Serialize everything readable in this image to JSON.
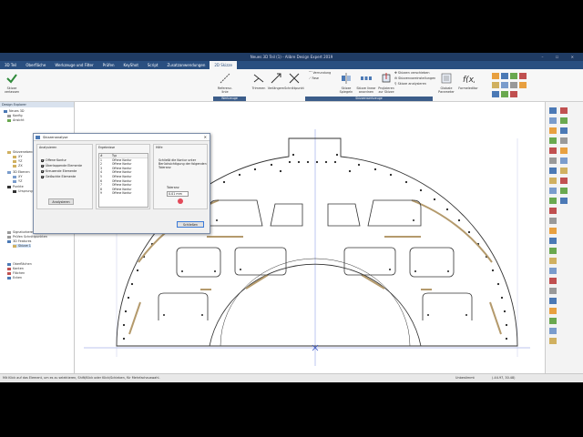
{
  "window": {
    "title": "Neues 3D Teil (1) - Alibre Design Expert 2019",
    "controls": "–  ☐  ✕"
  },
  "menu": [
    {
      "label": "3D Teil",
      "active": false
    },
    {
      "label": "Oberfläche",
      "active": false
    },
    {
      "label": "Werkzeuge und Filter",
      "active": false
    },
    {
      "label": "Prüfen",
      "active": false
    },
    {
      "label": "KeyShot",
      "active": false
    },
    {
      "label": "Script",
      "active": false
    },
    {
      "label": "Zusatzanwendungen",
      "active": false
    },
    {
      "label": "2D Skizze",
      "active": true
    }
  ],
  "ribbon": {
    "buttons": [
      {
        "label": "Skizze verlassen",
        "icon": "exit-sketch-icon"
      },
      {
        "label": "Referenz-linie",
        "icon": "reference-line-icon"
      },
      {
        "label": "Trimmen",
        "icon": "trim-icon"
      },
      {
        "label": "Verlängern",
        "icon": "extend-icon"
      },
      {
        "label": "Schnittpunkt",
        "icon": "intersection-icon"
      },
      {
        "label": "Skizze Spiegeln",
        "icon": "mirror-sketch-icon"
      },
      {
        "label": "Skizze linear anordnen",
        "icon": "linear-pattern-icon"
      },
      {
        "label": "Projizieren zur Skizze",
        "icon": "project-to-sketch-icon"
      },
      {
        "label": "Globale Parameter",
        "icon": "global-parameters-icon"
      },
      {
        "label": "Formeleditor",
        "icon": "formula-editor-icon"
      }
    ],
    "small_items": [
      "Verrundung",
      "Fase",
      "Skizzen verschieben",
      "Skizzenvoreinstellungen",
      "Skizze analysieren"
    ],
    "group_labels": [
      "Werkzeuge",
      "Skizzenwerkzeuge"
    ]
  },
  "explorer": {
    "title": "Design Explorer",
    "items": [
      "Neues 3D",
      "Konfig",
      "Ansicht",
      "Skizzenebenen",
      "XY",
      "YZ",
      "ZX",
      "3D Ebenen",
      "XY",
      "YZ",
      "Punkte",
      "Ursprung",
      "Signaturbereich",
      "Prüfen Schnittpunkten",
      "3D Features",
      "Oberflächen",
      "Kanten",
      "Flächen",
      "Ecken"
    ],
    "selected_item": "Skizze 1"
  },
  "dialog": {
    "title": "Skizzenanalyse",
    "close": "✕",
    "analyze_section_label": "Analysieren",
    "checks": [
      {
        "label": "Offene Kontur",
        "checked": true
      },
      {
        "label": "Überlappende Elemente",
        "checked": true
      },
      {
        "label": "Kreuzende Elemente",
        "checked": true
      },
      {
        "label": "Gelöschte Elemente",
        "checked": true
      }
    ],
    "analyze_button": "Analysieren",
    "results_label": "Ergebnisse",
    "results_columns": [
      "#",
      "Typ"
    ],
    "results_rows": [
      [
        "1",
        "Offene Kontur"
      ],
      [
        "2",
        "Offene Kontur"
      ],
      [
        "3",
        "Offene Kontur"
      ],
      [
        "4",
        "Offene Kontur"
      ],
      [
        "5",
        "Offene Kontur"
      ],
      [
        "6",
        "Offene Kontur"
      ],
      [
        "7",
        "Offene Kontur"
      ],
      [
        "8",
        "Offene Kontur"
      ],
      [
        "9",
        "Offene Kontur"
      ]
    ],
    "help_label": "Hilfe",
    "help_text_1": "Schließt die Kontur unter",
    "help_text_2": "Berücksichtigung der folgenden",
    "help_text_3": "Toleranz",
    "tolerance_label": "Toleranz",
    "tolerance_value": "0.01 mm",
    "close_button": "Schließen"
  },
  "status": {
    "left": "Mit Klick auf das Element, um es zu selektieren, Shift/Klick oder Klick/Schieben, für Mehrfachauswahl.",
    "middle": "Unbestimmt",
    "coords": "(-44.97, 30.48)"
  },
  "colors": {
    "titlebar": "#1f3b63",
    "menubar": "#2a4f80",
    "accent": "#3c5d8a",
    "sketch_line": "#333333",
    "slot_fill": "#d8c8a8"
  }
}
